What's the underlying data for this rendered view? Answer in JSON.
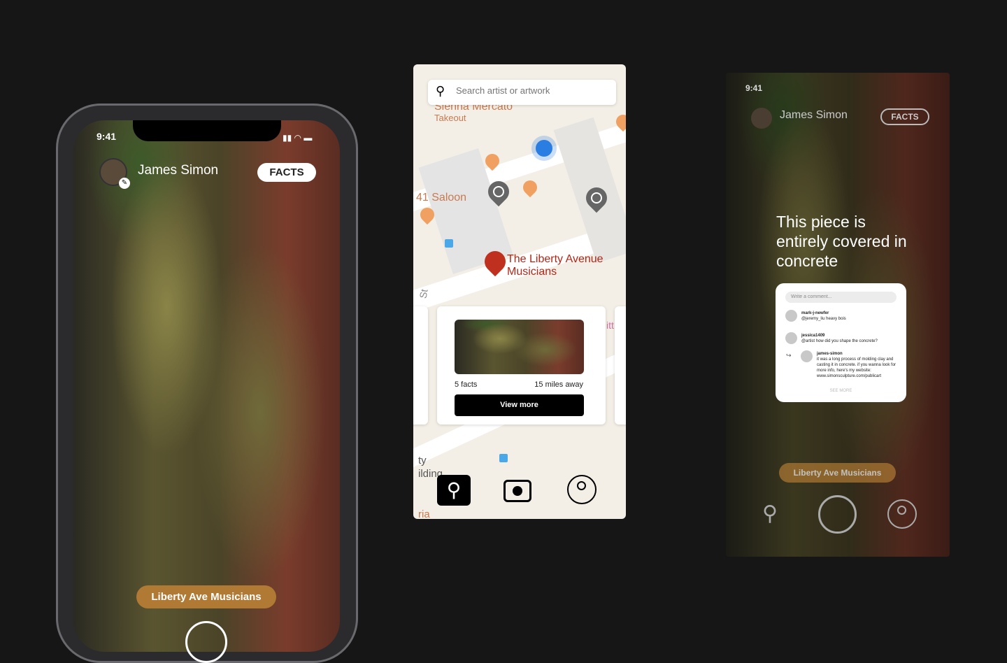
{
  "left_screen": {
    "time": "9:41",
    "artist_name": "James Simon",
    "facts_button": "FACTS",
    "artwork_pill": "Liberty Ave Musicians"
  },
  "map_screen": {
    "search": {
      "placeholder": "Search artist or artwork"
    },
    "map_labels": {
      "restaurant": "Sienna Mercato",
      "restaurant_sub": "Takeout",
      "saloon": "41 Saloon",
      "street": "St",
      "partial_1": "ty",
      "partial_2": "ilding",
      "partial_3": "ria",
      "partial_4": "itt"
    },
    "selected_artwork": "The Liberty Avenue Musicians",
    "card": {
      "facts": "5 facts",
      "distance": "15 miles away",
      "button": "View more"
    },
    "nav": [
      "search-icon",
      "camera-icon",
      "profile-icon"
    ],
    "active_nav": "search"
  },
  "right_screen": {
    "time": "9:41",
    "artist_name": "James Simon",
    "facts_button": "FACTS",
    "fact_text": "This piece is entirely covered in concrete",
    "comments": {
      "placeholder": "Write a comment...",
      "items": [
        {
          "user": "mark-j-newfer",
          "text": "@jeremy_liu heavy bois"
        },
        {
          "user": "jessica1409",
          "text": "@artist how did you shape the concrete?"
        },
        {
          "user": "james-simon",
          "text": "it was a long process of molding clay and casting it in concrete. if you wanna look for more info, here's my website: www.simonsculpture.com/publicart",
          "reply": true
        }
      ],
      "see_more": "SEE MORE"
    },
    "artwork_pill": "Liberty Ave Musicians"
  },
  "colors": {
    "background": "#161616",
    "accent_pill": "#b07a34",
    "map_pin": "#c0301e",
    "user_location": "#2a7de1"
  }
}
